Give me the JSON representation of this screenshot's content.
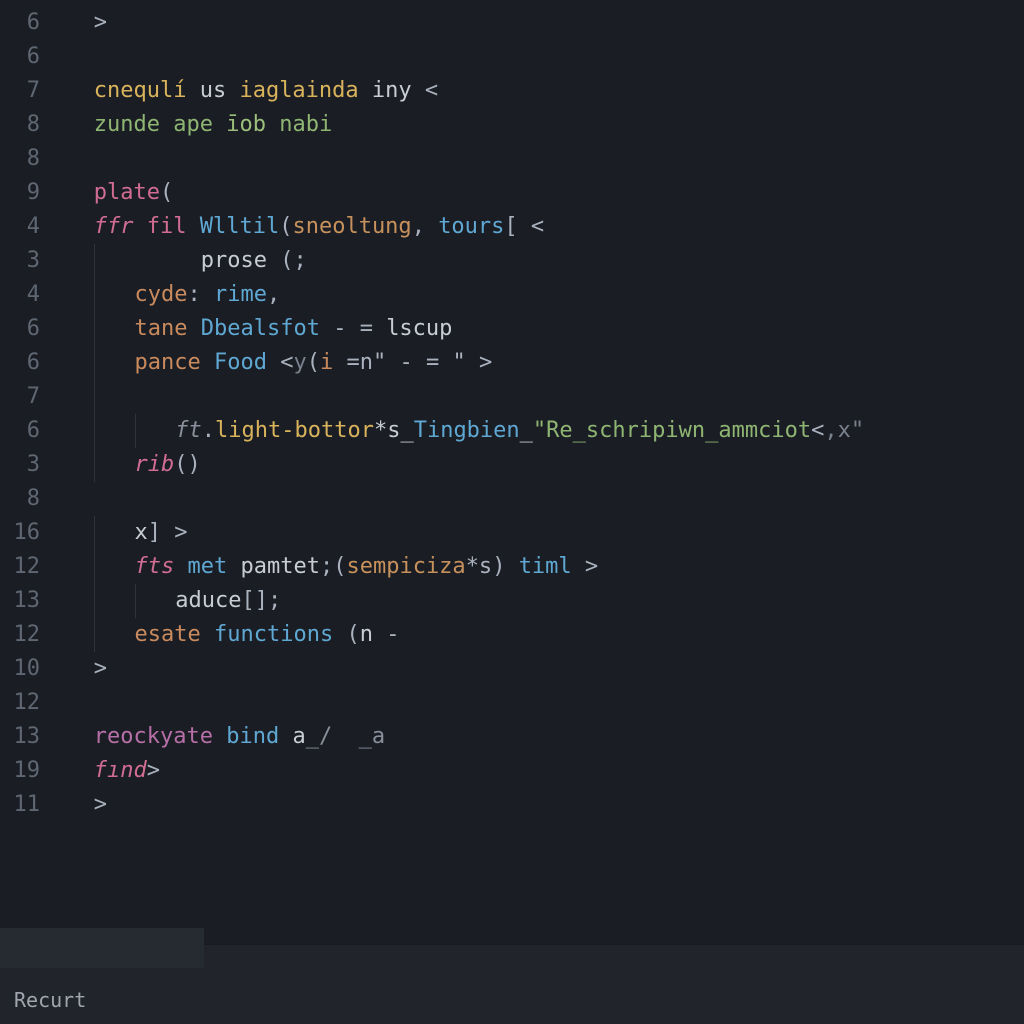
{
  "gutter": [
    "6",
    "6",
    "7",
    "8",
    "8",
    "9",
    "4",
    "3",
    "4",
    "6",
    "6",
    "7",
    "6",
    "3",
    "8",
    "16",
    "12",
    "13",
    "12",
    "10",
    "12",
    "13",
    "19",
    "11"
  ],
  "lines": [
    {
      "indent": 1,
      "tokens": [
        {
          "t": ">",
          "c": "tk-punct"
        }
      ]
    },
    {
      "indent": 0,
      "tokens": []
    },
    {
      "indent": 1,
      "tokens": [
        {
          "t": "cnequlí",
          "c": "tk-func"
        },
        {
          "t": " us ",
          "c": "tk-default"
        },
        {
          "t": "iaglainda",
          "c": "tk-func"
        },
        {
          "t": " iny ",
          "c": "tk-default"
        },
        {
          "t": "<",
          "c": "tk-punct"
        }
      ]
    },
    {
      "indent": 1,
      "tokens": [
        {
          "t": "zunde",
          "c": "tk-string"
        },
        {
          "t": " ape ",
          "c": "tk-string"
        },
        {
          "t": "īob",
          "c": "tk-str2"
        },
        {
          "t": " nabi",
          "c": "tk-string"
        }
      ]
    },
    {
      "indent": 0,
      "tokens": []
    },
    {
      "indent": 1,
      "tokens": [
        {
          "t": "plate",
          "c": "tk-keyword"
        },
        {
          "t": "(",
          "c": "tk-punct"
        }
      ]
    },
    {
      "indent": 1,
      "tokens": [
        {
          "t": "ffr",
          "c": "tk-keyword tk-italic"
        },
        {
          "t": " fil ",
          "c": "tk-keyword"
        },
        {
          "t": "Wlltil",
          "c": "tk-type"
        },
        {
          "t": "(",
          "c": "tk-punct"
        },
        {
          "t": "sneoltung",
          "c": "tk-param"
        },
        {
          "t": ", ",
          "c": "tk-punct"
        },
        {
          "t": "tours",
          "c": "tk-type"
        },
        {
          "t": "[ <",
          "c": "tk-punct"
        }
      ]
    },
    {
      "indent": 3,
      "guides": [
        1
      ],
      "tokens": [
        {
          "t": "  prose ",
          "c": "tk-default"
        },
        {
          "t": "(;",
          "c": "tk-punct"
        }
      ]
    },
    {
      "indent": 2,
      "guides": [
        1
      ],
      "tokens": [
        {
          "t": "cyde",
          "c": "tk-orange"
        },
        {
          "t": ": ",
          "c": "tk-punct"
        },
        {
          "t": "rime",
          "c": "tk-type"
        },
        {
          "t": ",",
          "c": "tk-punct"
        }
      ]
    },
    {
      "indent": 2,
      "guides": [
        1
      ],
      "tokens": [
        {
          "t": "tane ",
          "c": "tk-orange"
        },
        {
          "t": "Dbealsfot",
          "c": "tk-type"
        },
        {
          "t": " - = ",
          "c": "tk-punct"
        },
        {
          "t": "lscup",
          "c": "tk-default"
        }
      ]
    },
    {
      "indent": 2,
      "guides": [
        1
      ],
      "tokens": [
        {
          "t": "pance ",
          "c": "tk-orange"
        },
        {
          "t": "Food",
          "c": "tk-type"
        },
        {
          "t": " <",
          "c": "tk-punct"
        },
        {
          "t": "y",
          "c": "tk-comment"
        },
        {
          "t": "(",
          "c": "tk-punct"
        },
        {
          "t": "i",
          "c": "tk-orange"
        },
        {
          "t": " =",
          "c": "tk-punct"
        },
        {
          "t": "n\"",
          "c": "tk-punct"
        },
        {
          "t": " - = \" ",
          "c": "tk-punct"
        },
        {
          "t": ">",
          "c": "tk-punct"
        }
      ]
    },
    {
      "indent": 2,
      "guides": [
        1,
        2
      ],
      "tokens": []
    },
    {
      "indent": 3,
      "guides": [
        1,
        2
      ],
      "tokens": [
        {
          "t": "ft",
          "c": "tk-pale tk-italic"
        },
        {
          "t": ".",
          "c": "tk-punct"
        },
        {
          "t": "light-bottor",
          "c": "tk-func"
        },
        {
          "t": "*s_",
          "c": "tk-default"
        },
        {
          "t": "Tingbien",
          "c": "tk-type"
        },
        {
          "t": "_",
          "c": "tk-default"
        },
        {
          "t": "\"Re_schripiwn_ammciot",
          "c": "tk-string"
        },
        {
          "t": "<",
          "c": "tk-punct"
        },
        {
          "t": ",x\"",
          "c": "tk-comment"
        }
      ]
    },
    {
      "indent": 2,
      "guides": [
        1
      ],
      "tokens": [
        {
          "t": "rib",
          "c": "tk-keyword tk-italic"
        },
        {
          "t": "()",
          "c": "tk-punct"
        }
      ]
    },
    {
      "indent": 0,
      "guides": [
        1
      ],
      "tokens": []
    },
    {
      "indent": 2,
      "guides": [
        1
      ],
      "tokens": [
        {
          "t": "x",
          "c": "tk-default"
        },
        {
          "t": "] >",
          "c": "tk-punct"
        }
      ]
    },
    {
      "indent": 2,
      "guides": [
        1
      ],
      "tokens": [
        {
          "t": "fts",
          "c": "tk-keyword tk-italic"
        },
        {
          "t": " met ",
          "c": "tk-type"
        },
        {
          "t": "pamtet",
          "c": "tk-default"
        },
        {
          "t": ";(",
          "c": "tk-punct"
        },
        {
          "t": "sempiciza",
          "c": "tk-param"
        },
        {
          "t": "*s",
          "c": "tk-punct"
        },
        {
          "t": ") ",
          "c": "tk-punct"
        },
        {
          "t": "timl",
          "c": "tk-type"
        },
        {
          "t": " >",
          "c": "tk-punct"
        }
      ]
    },
    {
      "indent": 3,
      "guides": [
        1,
        2
      ],
      "tokens": [
        {
          "t": "aduce",
          "c": "tk-default"
        },
        {
          "t": "[];",
          "c": "tk-punct"
        }
      ]
    },
    {
      "indent": 2,
      "guides": [
        1
      ],
      "tokens": [
        {
          "t": "esate",
          "c": "tk-orange"
        },
        {
          "t": " ",
          "c": "tk-default"
        },
        {
          "t": "functions",
          "c": "tk-type"
        },
        {
          "t": " (",
          "c": "tk-punct"
        },
        {
          "t": "n ",
          "c": "tk-default"
        },
        {
          "t": "-",
          "c": "tk-punct"
        }
      ]
    },
    {
      "indent": 1,
      "tokens": [
        {
          "t": ">",
          "c": "tk-punct"
        }
      ]
    },
    {
      "indent": 0,
      "tokens": []
    },
    {
      "indent": 1,
      "tokens": [
        {
          "t": "reockyate",
          "c": "tk-keyword2"
        },
        {
          "t": " ",
          "c": "tk-default"
        },
        {
          "t": "bind",
          "c": "tk-type"
        },
        {
          "t": " a",
          "c": "tk-default"
        },
        {
          "t": "_/  _a",
          "c": "tk-pale"
        }
      ]
    },
    {
      "indent": 1,
      "tokens": [
        {
          "t": "fınd",
          "c": "tk-keyword tk-italic"
        },
        {
          "t": ">",
          "c": "tk-punct"
        }
      ]
    },
    {
      "indent": 1,
      "tokens": [
        {
          "t": ">",
          "c": "tk-punct"
        }
      ]
    }
  ],
  "status": {
    "label": "Recurt"
  },
  "indent_unit": "   "
}
